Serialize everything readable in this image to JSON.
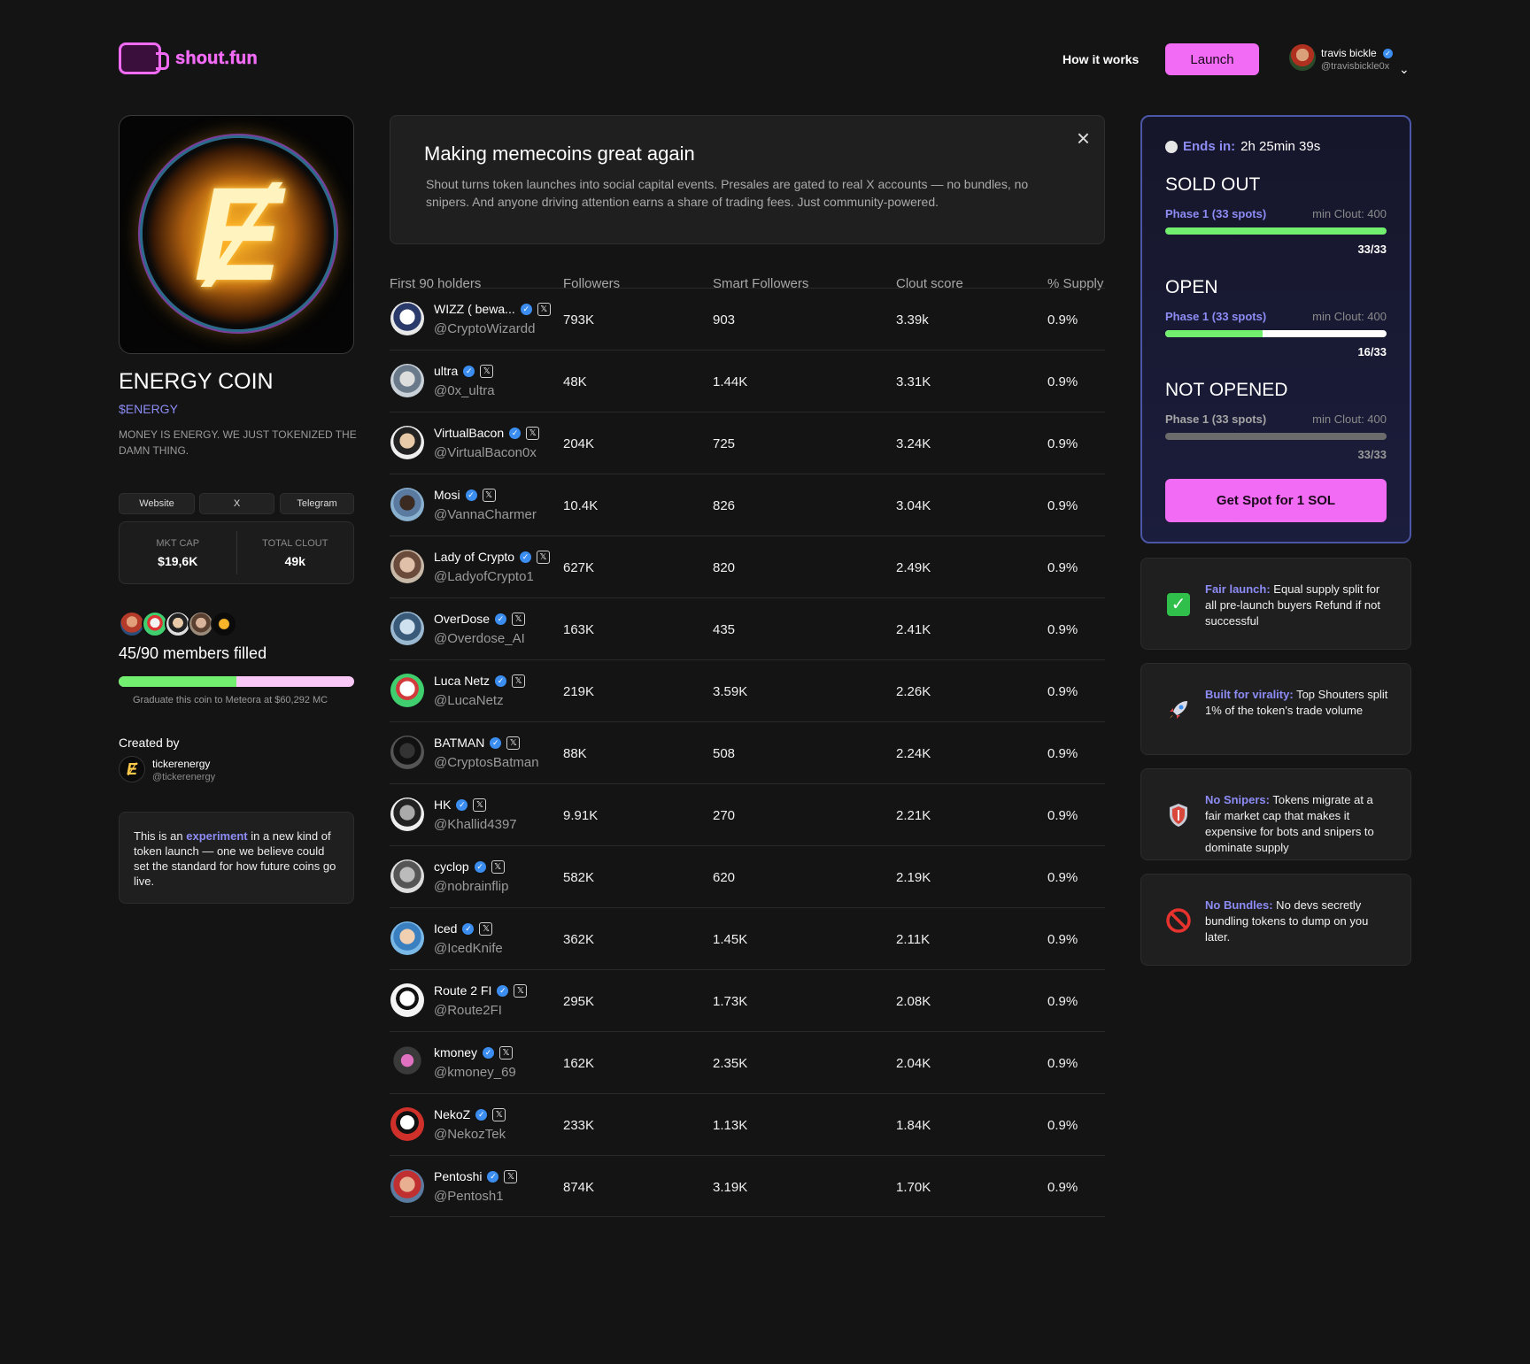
{
  "brand": {
    "logo_text": "shout.fun"
  },
  "nav": {
    "how_it_works": "How it works",
    "launch": "Launch"
  },
  "user": {
    "name": "travis bickle",
    "handle": "@travisbickle0x",
    "verified_icon": "verified-badge-icon"
  },
  "coin": {
    "name": "ENERGY COIN",
    "ticker": "$ENERGY",
    "description": "MONEY IS ENERGY. WE JUST TOKENIZED THE DAMN THING.",
    "links": [
      "Website",
      "X",
      "Telegram"
    ],
    "mkt_cap_label": "MKT CAP",
    "mkt_cap_value": "$19,6K",
    "total_clout_label": "TOTAL CLOUT",
    "total_clout_value": "49k",
    "members_text": "45/90 members filled",
    "members_fraction": 0.5,
    "graduate_text": "Graduate this coin to Meteora at $60,292 MC",
    "created_by_label": "Created by",
    "creator_name": "tickerenergy",
    "creator_handle": "@tickerenergy",
    "note_pre": "This is an ",
    "note_highlight": "experiment",
    "note_post": " in a new kind of token launch — one we believe could set the standard for how future coins go live."
  },
  "banner": {
    "title": "Making memecoins great again",
    "text": "Shout turns token launches into social capital events. Presales are gated to real X accounts — no bundles, no snipers. And anyone driving attention earns a share of trading fees. Just community-powered.",
    "close_icon": "close-icon"
  },
  "table": {
    "headers": [
      "First 90 holders",
      "Followers",
      "Smart Followers",
      "Clout score",
      "% Supply"
    ],
    "rows": [
      {
        "name": "WIZZ ( bewa...",
        "handle": "@CryptoWizardd",
        "followers": "793K",
        "smart": "903",
        "clout": "3.39k",
        "supply": "0.9%"
      },
      {
        "name": "ultra",
        "handle": "@0x_ultra",
        "followers": "48K",
        "smart": "1.44K",
        "clout": "3.31K",
        "supply": "0.9%"
      },
      {
        "name": "VirtualBacon",
        "handle": "@VirtualBacon0x",
        "followers": "204K",
        "smart": "725",
        "clout": "3.24K",
        "supply": "0.9%"
      },
      {
        "name": "Mosi",
        "handle": "@VannaCharmer",
        "followers": "10.4K",
        "smart": "826",
        "clout": "3.04K",
        "supply": "0.9%"
      },
      {
        "name": "Lady of Crypto",
        "handle": "@LadyofCrypto1",
        "followers": "627K",
        "smart": "820",
        "clout": "2.49K",
        "supply": "0.9%"
      },
      {
        "name": "OverDose",
        "handle": "@Overdose_AI",
        "followers": "163K",
        "smart": "435",
        "clout": "2.41K",
        "supply": "0.9%"
      },
      {
        "name": "Luca Netz",
        "handle": "@LucaNetz",
        "followers": "219K",
        "smart": "3.59K",
        "clout": "2.26K",
        "supply": "0.9%"
      },
      {
        "name": "BATMAN",
        "handle": "@CryptosBatman",
        "followers": "88K",
        "smart": "508",
        "clout": "2.24K",
        "supply": "0.9%"
      },
      {
        "name": "HK",
        "handle": "@Khallid4397",
        "followers": "9.91K",
        "smart": "270",
        "clout": "2.21K",
        "supply": "0.9%"
      },
      {
        "name": "cyclop",
        "handle": "@nobrainflip",
        "followers": "582K",
        "smart": "620",
        "clout": "2.19K",
        "supply": "0.9%"
      },
      {
        "name": "Iced",
        "handle": "@IcedKnife",
        "followers": "362K",
        "smart": "1.45K",
        "clout": "2.11K",
        "supply": "0.9%"
      },
      {
        "name": "Route 2 FI",
        "handle": "@Route2FI",
        "followers": "295K",
        "smart": "1.73K",
        "clout": "2.08K",
        "supply": "0.9%"
      },
      {
        "name": "kmoney",
        "handle": "@kmoney_69",
        "followers": "162K",
        "smart": "2.35K",
        "clout": "2.04K",
        "supply": "0.9%"
      },
      {
        "name": "NekoZ",
        "handle": "@NekozTek",
        "followers": "233K",
        "smart": "1.13K",
        "clout": "1.84K",
        "supply": "0.9%"
      },
      {
        "name": "Pentoshi",
        "handle": "@Pentosh1",
        "followers": "874K",
        "smart": "3.19K",
        "clout": "1.70K",
        "supply": "0.9%"
      }
    ]
  },
  "presale": {
    "ends_label": "Ends in:",
    "ends_value": "2h 25min 39s",
    "phases": [
      {
        "status": "SOLD OUT",
        "name": "Phase 1 (33 spots)",
        "min": "min Clout: 400",
        "count": "33/33",
        "fill": 1.0
      },
      {
        "status": "OPEN",
        "name": "Phase 1 (33 spots)",
        "min": "min Clout: 400",
        "count": "16/33",
        "fill": 0.44
      },
      {
        "status": "NOT OPENED",
        "name": "Phase 1 (33 spots)",
        "min": "min Clout: 400",
        "count": "33/33",
        "fill": 0
      }
    ],
    "cta": "Get Spot for 1 SOL"
  },
  "features": [
    {
      "icon": "check-icon",
      "key": "Fair launch:",
      "text": " Equal supply split for all pre-launch buyers Refund if not successful"
    },
    {
      "icon": "rocket-icon",
      "key": "Built for virality:",
      "text": " Top Shouters split 1% of the token's trade volume"
    },
    {
      "icon": "shield-icon",
      "key": "No Snipers:",
      "text": " Tokens migrate at a fair market cap that makes it expensive for bots and snipers to dominate supply"
    },
    {
      "icon": "no-entry-icon",
      "key": "No Bundles:",
      "text": " No devs secretly bundling tokens to dump on you later."
    }
  ],
  "colors": {
    "accent": "#f26bf5",
    "link": "#8d8cf5",
    "progress": "#72ef6f",
    "background": "#141414"
  }
}
